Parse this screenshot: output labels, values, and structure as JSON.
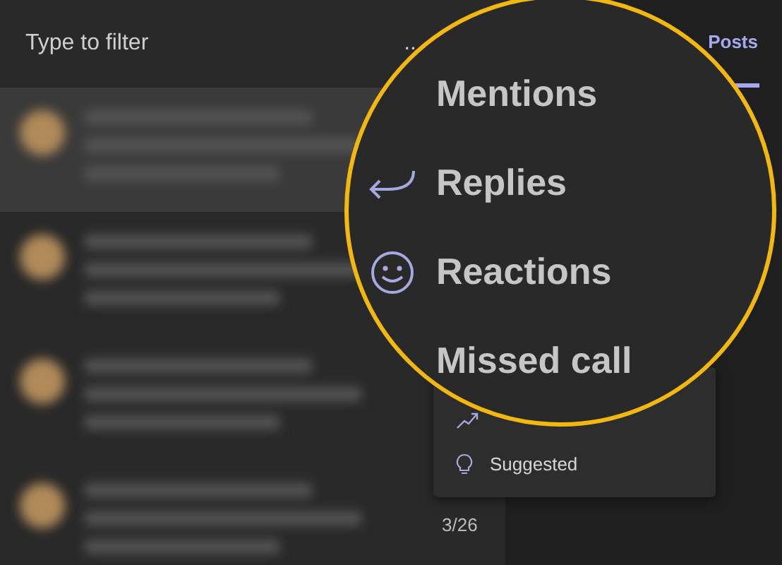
{
  "filter": {
    "placeholder": "Type to filter"
  },
  "more_button": "..",
  "tabs": [
    {
      "label": "Posts",
      "selected": true
    }
  ],
  "messages": [
    {
      "selected": true
    },
    {
      "selected": false
    },
    {
      "selected": false
    },
    {
      "selected": false,
      "date": "3/26"
    }
  ],
  "menu": {
    "items": [
      {
        "label": "Suggested"
      }
    ]
  },
  "magnifier": {
    "items": [
      {
        "label": "Mentions"
      },
      {
        "label": "Replies"
      },
      {
        "label": "Reactions"
      },
      {
        "label": "Missed call"
      }
    ]
  }
}
